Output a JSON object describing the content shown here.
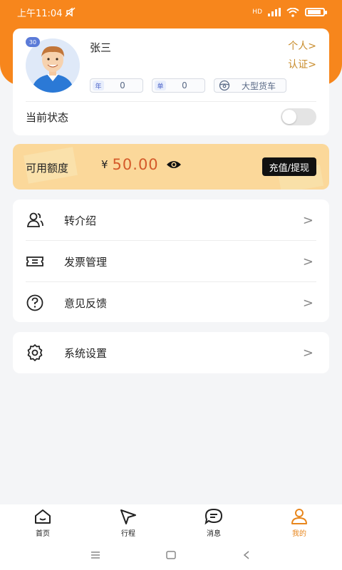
{
  "status_bar": {
    "time": "上午11:04",
    "signal_label": "HD"
  },
  "profile": {
    "name": "张三",
    "age_badge": "30",
    "link_personal": "个人>",
    "link_verify": "认证>",
    "chip_year_tag": "年",
    "chip_year_value": "0",
    "chip_order_tag": "单",
    "chip_order_value": "0",
    "vehicle_type": "大型货车",
    "status_label": "当前状态"
  },
  "balance": {
    "label": "可用额度",
    "currency": "¥",
    "amount": "50.00",
    "button": "充值/提现"
  },
  "menu": {
    "items": [
      {
        "label": "转介绍",
        "icon": "users-icon"
      },
      {
        "label": "发票管理",
        "icon": "ticket-icon"
      },
      {
        "label": "意见反馈",
        "icon": "question-icon"
      }
    ],
    "settings": {
      "label": "系统设置",
      "icon": "gear-icon"
    },
    "chevron": ">"
  },
  "tabbar": {
    "tabs": [
      {
        "label": "首页",
        "icon": "home-icon"
      },
      {
        "label": "行程",
        "icon": "navigation-icon"
      },
      {
        "label": "消息",
        "icon": "message-icon"
      },
      {
        "label": "我的",
        "icon": "user-icon"
      }
    ],
    "active_index": 3
  },
  "colors": {
    "brand": "#f7861c",
    "balance_bg": "#fbd89a",
    "amount": "#d45a2a",
    "link": "#c88b2a"
  }
}
